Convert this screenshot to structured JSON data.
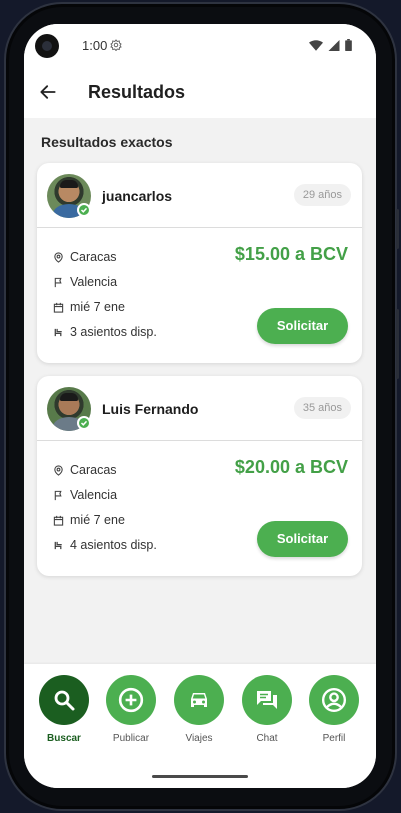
{
  "status_bar": {
    "time": "1:00"
  },
  "app_bar": {
    "title": "Resultados"
  },
  "section_title": "Resultados exactos",
  "results": [
    {
      "username": "juancarlos",
      "age": "29 años",
      "origin": "Caracas",
      "destination": "Valencia",
      "date": "mié 7 ene",
      "seats": "3 asientos disp.",
      "price": "$15.00 a BCV",
      "button": "Solicitar"
    },
    {
      "username": "Luis Fernando",
      "age": "35 años",
      "origin": "Caracas",
      "destination": "Valencia",
      "date": "mié 7 ene",
      "seats": "4 asientos disp.",
      "price": "$20.00 a BCV",
      "button": "Solicitar"
    }
  ],
  "bottom_nav": [
    {
      "label": "Buscar",
      "icon": "search-icon",
      "active": true
    },
    {
      "label": "Publicar",
      "icon": "add-circle-icon",
      "active": false
    },
    {
      "label": "Viajes",
      "icon": "car-icon",
      "active": false
    },
    {
      "label": "Chat",
      "icon": "chat-icon",
      "active": false
    },
    {
      "label": "Perfil",
      "icon": "profile-icon",
      "active": false
    }
  ],
  "colors": {
    "primary": "#4caf50",
    "primary_dark": "#1b5e20",
    "price": "#43a047"
  }
}
